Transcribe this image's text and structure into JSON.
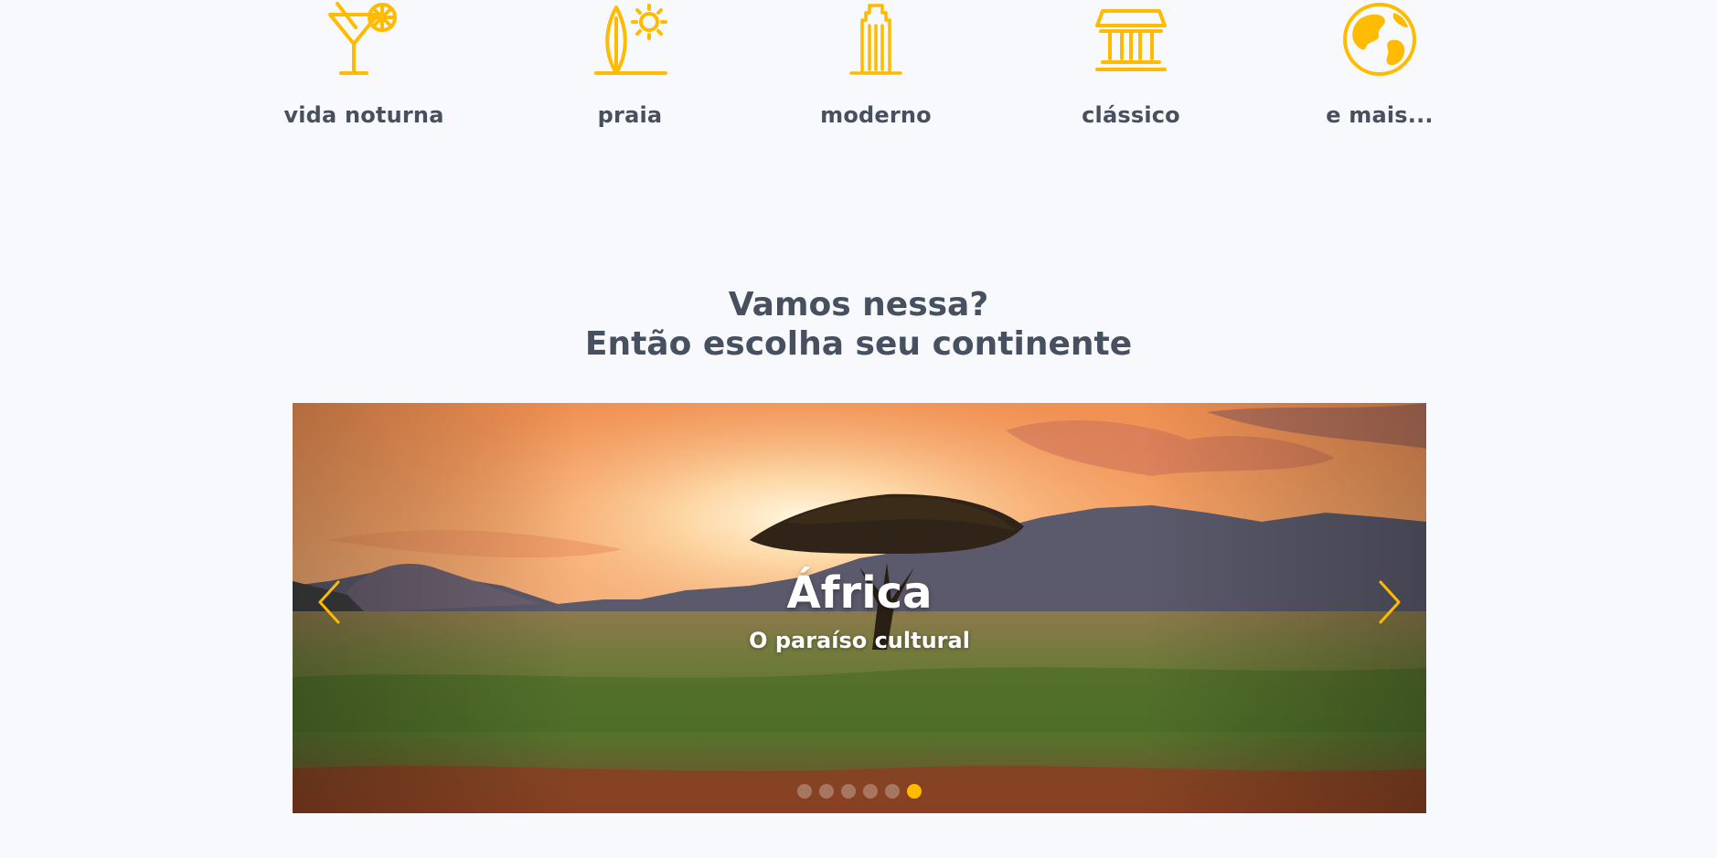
{
  "colors": {
    "accent": "#ffbb00",
    "text": "#47505f",
    "background": "#f7f9fc"
  },
  "travel_types": [
    {
      "label": "vida noturna",
      "icon": "cocktail-icon"
    },
    {
      "label": "praia",
      "icon": "surfboard-sun-icon"
    },
    {
      "label": "moderno",
      "icon": "skyscraper-icon"
    },
    {
      "label": "clássico",
      "icon": "classical-building-icon"
    },
    {
      "label": "e mais...",
      "icon": "globe-icon"
    }
  ],
  "heading": {
    "line1": "Vamos nessa?",
    "line2": "Então escolha seu continente"
  },
  "carousel": {
    "slide_title": "África",
    "slide_subtitle": "O paraíso cultural",
    "image": "savanna-sunset-image",
    "prev_icon": "chevron-left-icon",
    "next_icon": "chevron-right-icon",
    "slide_count": 6,
    "active_index": 5
  }
}
